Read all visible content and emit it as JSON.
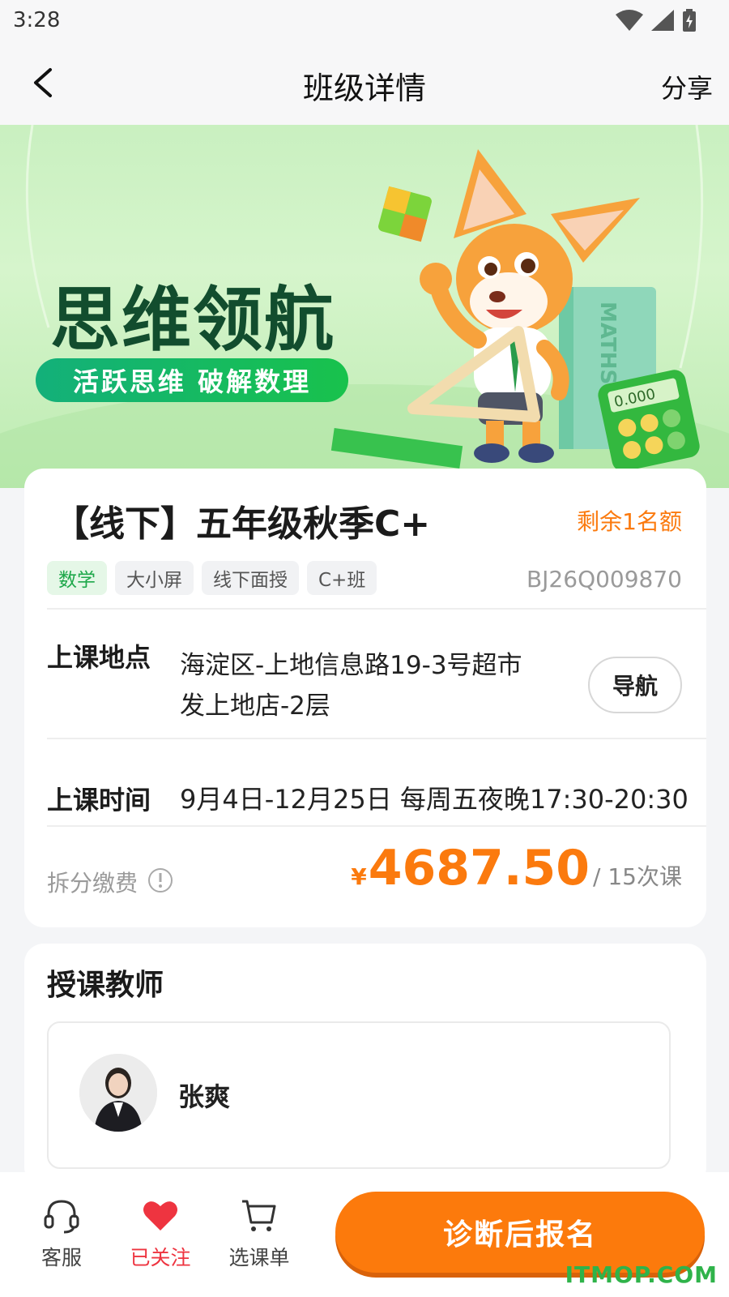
{
  "status_bar": {
    "time": "3:28"
  },
  "nav": {
    "title": "班级详情",
    "share": "分享"
  },
  "banner": {
    "title": "思维领航",
    "subtitle": "活跃思维 破解数理",
    "book_text": "MATHS",
    "calculator_display": "0.000"
  },
  "course": {
    "title": "【线下】五年级秋季C+",
    "quota": "剩余1名额",
    "tags": [
      "数学",
      "大小屏",
      "线下面授",
      "C+班"
    ],
    "code": "BJ26Q009870",
    "location_label": "上课地点",
    "location_line1": "海淀区-上地信息路19-3号超市",
    "location_line2": "发上地店-2层",
    "navigate_button": "导航",
    "time_label": "上课时间",
    "time_value": "9月4日-12月25日 每周五夜晚17:30-20:30",
    "split_pay_label": "拆分缴费",
    "currency": "¥",
    "price": "4687.50",
    "price_unit": "/ 15次课"
  },
  "teacher": {
    "heading": "授课教师",
    "name": "张爽"
  },
  "bottom_bar": {
    "service": "客服",
    "followed": "已关注",
    "cart": "选课单",
    "cta": "诊断后报名"
  },
  "watermark": "ITMOP.COM",
  "colors": {
    "accent": "#fc7a0c",
    "followed": "#ee3440",
    "tag_green": "#1ea84a"
  }
}
